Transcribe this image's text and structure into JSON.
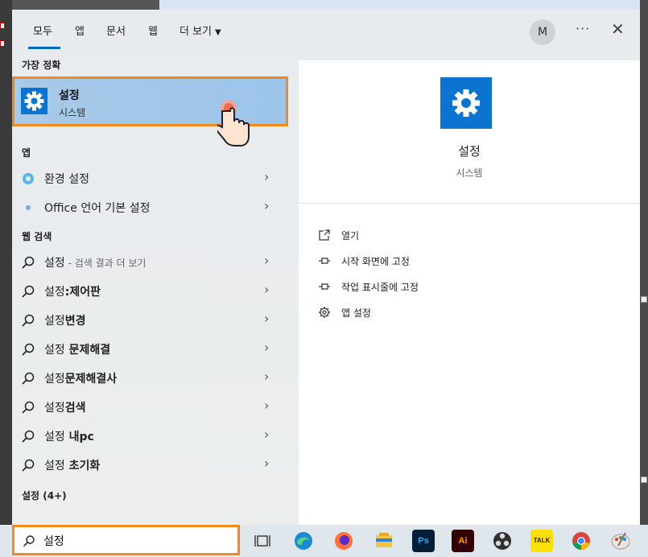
{
  "tabs": [
    {
      "label": "모두",
      "active": true
    },
    {
      "label": "앱"
    },
    {
      "label": "문서"
    },
    {
      "label": "웹"
    },
    {
      "label": "더 보기"
    }
  ],
  "header": {
    "avatar_initial": "M",
    "more": "···",
    "close": "✕"
  },
  "left": {
    "best_match_heading": "가장 정확",
    "best_match": {
      "title": "설정",
      "subtitle": "시스템",
      "icon": "gear-icon"
    },
    "apps_heading": "앱",
    "apps": [
      {
        "label": "환경 설정",
        "icon": "control-panel-icon"
      },
      {
        "label": "Office 언어 기본 설정",
        "icon": "office-settings-icon"
      }
    ],
    "web_heading": "웹 검색",
    "web": [
      {
        "label": "설정",
        "suffix": " - 검색 결과 더 보기"
      },
      {
        "label": "설정",
        "bold": ":제어판"
      },
      {
        "label": "설정",
        "bold": "변경"
      },
      {
        "label": "설정",
        "bold": " 문제해결"
      },
      {
        "label": "설정",
        "bold": "문제해결사"
      },
      {
        "label": "설정",
        "bold": "검색"
      },
      {
        "label": "설정",
        "bold": " 내pc"
      },
      {
        "label": "설정",
        "bold": " 초기화"
      }
    ],
    "settings_heading": "설정 (4+)"
  },
  "right": {
    "title": "설정",
    "subtitle": "시스템",
    "actions": [
      {
        "label": "열기",
        "icon": "open-icon"
      },
      {
        "label": "시작 화면에 고정",
        "icon": "pin-icon"
      },
      {
        "label": "작업 표시줄에 고정",
        "icon": "pin-icon"
      },
      {
        "label": "앱 설정",
        "icon": "gear-icon"
      }
    ]
  },
  "taskbar": {
    "search_value": "설정",
    "apps": [
      {
        "name": "task-view-icon"
      },
      {
        "name": "edge-icon"
      },
      {
        "name": "firefox-icon"
      },
      {
        "name": "file-explorer-icon"
      },
      {
        "name": "photoshop-icon",
        "text": "Ps"
      },
      {
        "name": "illustrator-icon",
        "text": "Ai"
      },
      {
        "name": "obs-icon"
      },
      {
        "name": "kakaotalk-icon",
        "text": "TALK"
      },
      {
        "name": "chrome-icon"
      },
      {
        "name": "paint-icon"
      }
    ]
  },
  "colors": {
    "accent": "#0067c0",
    "highlight": "#f08a1c",
    "settings_blue": "#0a74d0"
  }
}
